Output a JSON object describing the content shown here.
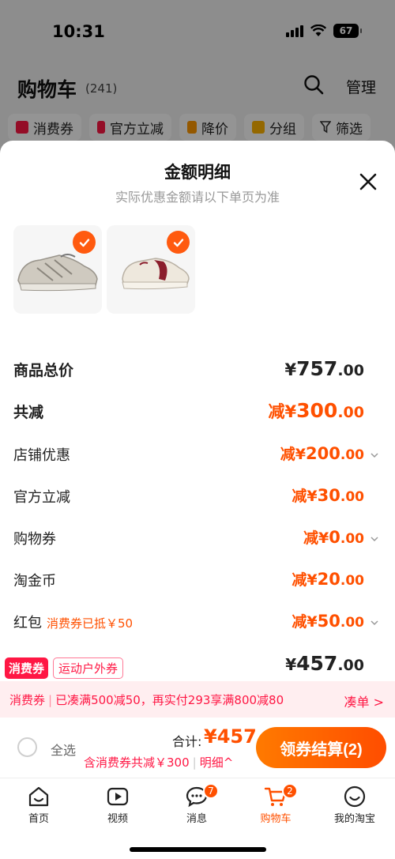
{
  "status": {
    "time": "10:31",
    "battery": "67"
  },
  "cart": {
    "title": "购物车",
    "count": "(241)",
    "manage": "管理",
    "filters": [
      {
        "label": "消费券",
        "color": "#ff1744"
      },
      {
        "label": "官方立减",
        "color": "#ff1744"
      },
      {
        "label": "降价",
        "color": "#ff9800"
      },
      {
        "label": "分组",
        "color": "#ffb300"
      },
      {
        "label": "筛选",
        "color": "#333333"
      }
    ]
  },
  "sheet": {
    "title": "金额明细",
    "subtitle": "实际优惠金额请以下单页为准",
    "rows": [
      {
        "label": "商品总价",
        "prefix": "",
        "yen": "¥",
        "int": "757",
        "dec": ".00"
      },
      {
        "label": "共减",
        "prefix": "减",
        "yen": "¥",
        "int": "300",
        "dec": ".00"
      },
      {
        "label": "店铺优惠",
        "prefix": "减",
        "yen": "¥",
        "int": "200",
        "dec": ".00"
      },
      {
        "label": "官方立减",
        "prefix": "减",
        "yen": "¥",
        "int": "30",
        "dec": ".00"
      },
      {
        "label": "购物券",
        "prefix": "减",
        "yen": "¥",
        "int": "0",
        "dec": ".00"
      },
      {
        "label": "淘金币",
        "prefix": "减",
        "yen": "¥",
        "int": "20",
        "dec": ".00"
      },
      {
        "label": "红包",
        "sublabel": "消费券已抵￥50",
        "prefix": "减",
        "yen": "¥",
        "int": "50",
        "dec": ".00"
      }
    ],
    "total": {
      "yen": "¥",
      "int": "457",
      "dec": ".00"
    },
    "tags": [
      "消费券",
      "运动户外券"
    ]
  },
  "promo": {
    "tag": "消费券",
    "text": "已凑满500减50，再实付293享满800减80",
    "action": "凑单 >"
  },
  "checkout": {
    "select_all": "全选",
    "sum_label": "合计:",
    "sum_amount": "¥457",
    "sum_sub": "含消费券共减￥300",
    "detail": "明细^",
    "pay_button": "领券结算(2)"
  },
  "tabs": [
    {
      "label": "首页",
      "icon": "home-icon"
    },
    {
      "label": "视频",
      "icon": "video-icon"
    },
    {
      "label": "消息",
      "icon": "message-icon",
      "badge": "7"
    },
    {
      "label": "购物车",
      "icon": "cart-icon",
      "badge": "2"
    },
    {
      "label": "我的淘宝",
      "icon": "profile-icon"
    }
  ],
  "colors": {
    "accent": "#ff5000",
    "promo_red": "#ff1744"
  }
}
